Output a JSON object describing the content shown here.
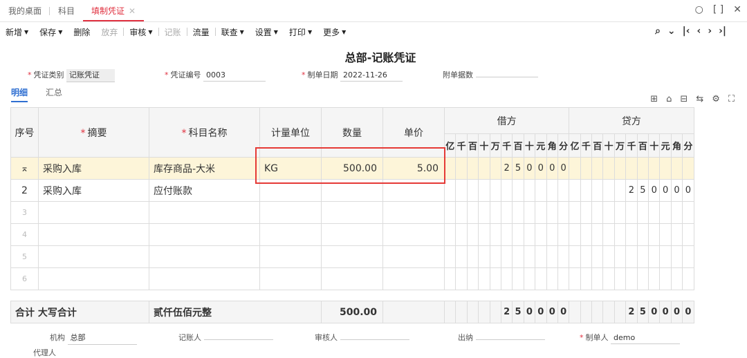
{
  "tabs": [
    {
      "label": "我的桌面"
    },
    {
      "label": "科目"
    },
    {
      "label": "填制凭证",
      "close": "✕"
    }
  ],
  "window_icons": {
    "search": "○",
    "restore": "[ ]",
    "close": "✕"
  },
  "toolbar": [
    {
      "label": "新增",
      "caret": true
    },
    {
      "label": "保存",
      "caret": true
    },
    {
      "label": "删除"
    },
    {
      "label": "放弃",
      "disabled": true
    },
    "sep",
    {
      "label": "审核",
      "caret": true
    },
    "sep",
    {
      "label": "记账",
      "disabled": true
    },
    "sep",
    {
      "label": "流量"
    },
    "sep",
    {
      "label": "联查",
      "caret": true
    },
    {
      "label": "设置",
      "caret": true
    },
    {
      "label": "打印",
      "caret": true
    },
    {
      "label": "更多",
      "caret": true
    }
  ],
  "nav": {
    "search": "⌕",
    "down": "⌄",
    "first": "|‹",
    "prev": "‹",
    "next": "›",
    "last": "›|"
  },
  "voucher_title": "总部-记账凭证",
  "fields": {
    "type_label": "凭证类别",
    "type_value": "记账凭证",
    "no_label": "凭证编号",
    "no_value": "0003",
    "date_label": "制单日期",
    "date_value": "2022-11-26",
    "attach_label": "附单据数",
    "attach_value": ""
  },
  "subtabs": [
    {
      "label": "明细"
    },
    {
      "label": "汇总"
    }
  ],
  "table": {
    "headers": {
      "seq": "序号",
      "summary": "摘要",
      "account": "科目名称",
      "unit": "计量单位",
      "qty": "数量",
      "price": "单价",
      "debit": "借方",
      "credit": "贷方"
    },
    "digits": [
      "亿",
      "千",
      "百",
      "十",
      "万",
      "千",
      "百",
      "十",
      "元",
      "角",
      "分"
    ],
    "rows": [
      {
        "seq": "⌅",
        "summary": "采购入库",
        "account": "库存商品-大米",
        "unit": "KG",
        "qty": "500.00",
        "price": "5.00",
        "debit": [
          "",
          "",
          "",
          "",
          "",
          "2",
          "5",
          "0",
          "0",
          "0",
          "0"
        ],
        "credit": [
          "",
          "",
          "",
          "",
          "",
          "",
          "",
          "",
          "",
          "",
          ""
        ]
      },
      {
        "seq": "2",
        "summary": "采购入库",
        "account": "应付账款",
        "unit": "",
        "qty": "",
        "price": "",
        "debit": [
          "",
          "",
          "",
          "",
          "",
          "",
          "",
          "",
          "",
          "",
          ""
        ],
        "credit": [
          "",
          "",
          "",
          "",
          "",
          "2",
          "5",
          "0",
          "0",
          "0",
          "0"
        ]
      },
      {
        "seq": "3",
        "summary": "",
        "account": "",
        "unit": "",
        "qty": "",
        "price": "",
        "debit": [
          "",
          "",
          "",
          "",
          "",
          "",
          "",
          "",
          "",
          "",
          ""
        ],
        "credit": [
          "",
          "",
          "",
          "",
          "",
          "",
          "",
          "",
          "",
          "",
          ""
        ]
      },
      {
        "seq": "4",
        "summary": "",
        "account": "",
        "unit": "",
        "qty": "",
        "price": "",
        "debit": [
          "",
          "",
          "",
          "",
          "",
          "",
          "",
          "",
          "",
          "",
          ""
        ],
        "credit": [
          "",
          "",
          "",
          "",
          "",
          "",
          "",
          "",
          "",
          "",
          ""
        ]
      },
      {
        "seq": "5",
        "summary": "",
        "account": "",
        "unit": "",
        "qty": "",
        "price": "",
        "debit": [
          "",
          "",
          "",
          "",
          "",
          "",
          "",
          "",
          "",
          "",
          ""
        ],
        "credit": [
          "",
          "",
          "",
          "",
          "",
          "",
          "",
          "",
          "",
          "",
          ""
        ]
      },
      {
        "seq": "6",
        "summary": "",
        "account": "",
        "unit": "",
        "qty": "",
        "price": "",
        "debit": [
          "",
          "",
          "",
          "",
          "",
          "",
          "",
          "",
          "",
          "",
          ""
        ],
        "credit": [
          "",
          "",
          "",
          "",
          "",
          "",
          "",
          "",
          "",
          "",
          ""
        ]
      }
    ],
    "total": {
      "label1": "合计",
      "label2": "大写合计",
      "words": "贰仟伍佰元整",
      "qty": "500.00",
      "debit": [
        "",
        "",
        "",
        "",
        "",
        "2",
        "5",
        "0",
        "0",
        "0",
        "0"
      ],
      "credit": [
        "",
        "",
        "",
        "",
        "",
        "2",
        "5",
        "0",
        "0",
        "0",
        "0"
      ]
    }
  },
  "footer": {
    "org_label": "机构",
    "org_value": "总部",
    "bookkeeper_label": "记账人",
    "auditor_label": "审核人",
    "cashier_label": "出纳",
    "maker_label": "制单人",
    "maker_value": "demo",
    "agent_label": "代理人"
  }
}
